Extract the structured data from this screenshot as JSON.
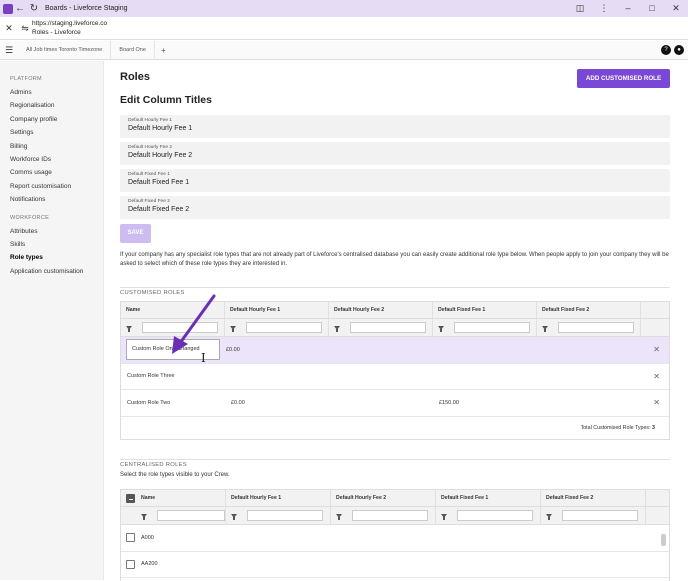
{
  "browser": {
    "window_title": "Boards - Liveforce Staging",
    "url": "https://staging.liveforce.co",
    "page_title": "Roles - Liveforce",
    "tabs": [
      "All Job times Toronto Timezone",
      "Board One"
    ],
    "help_glyph": "?",
    "bell_glyph": "●"
  },
  "sidebar": {
    "platform_heading": "PLATFORM",
    "platform_items": [
      "Admins",
      "Regionalisation",
      "Company profile",
      "Settings",
      "Billing",
      "Workforce IDs",
      "Comms usage",
      "Report customisation",
      "Notifications"
    ],
    "workforce_heading": "WORKFORCE",
    "workforce_items": [
      "Attributes",
      "Skills",
      "Role types",
      "Application customisation"
    ],
    "active_item": "Role types"
  },
  "main": {
    "title": "Roles",
    "add_button": "ADD CUSTOMISED ROLE",
    "edit_title": "Edit Column Titles",
    "fields": [
      {
        "label": "Default Hourly Fee 1",
        "value": "Default Hourly Fee 1"
      },
      {
        "label": "Default Hourly Fee 2",
        "value": "Default Hourly Fee 2"
      },
      {
        "label": "Default Fixed Fee 1",
        "value": "Default Fixed Fee 1"
      },
      {
        "label": "Default Fixed Fee 2",
        "value": "Default Fixed Fee 2"
      }
    ],
    "save_button": "SAVE",
    "info_text": "If your company has any specialist role types that are not already part of Liveforce's centralised database you can easily create additional role type below. When people apply to join your company they will be asked to select which of these role types they are interested in."
  },
  "customised": {
    "heading": "CUSTOMISED ROLES",
    "columns": [
      "Name",
      "Default Hourly Fee 1",
      "Default Hourly Fee 2",
      "Default Fixed Fee 1",
      "Default Fixed Fee 2"
    ],
    "rows": [
      {
        "name": "Custom Role One Changed",
        "hourly1": "£0.00",
        "hourly2": "",
        "fixed1": "",
        "fixed2": ""
      },
      {
        "name": "Custom Role Three",
        "hourly1": "",
        "hourly2": "",
        "fixed1": "",
        "fixed2": ""
      },
      {
        "name": "Custom Role Two",
        "hourly1": "£0.00",
        "hourly2": "",
        "fixed1": "£150.00",
        "fixed2": ""
      }
    ],
    "total_label": "Total Customised Role Types:",
    "total_value": "3"
  },
  "centralised": {
    "heading": "CENTRALISED ROLES",
    "subtitle": "Select the role types visible to your Crew.",
    "columns": [
      "Name",
      "Default Hourly Fee 1",
      "Default Hourly Fee 2",
      "Default Fixed Fee 1",
      "Default Fixed Fee 2"
    ],
    "rows": [
      "A000",
      "AA200"
    ]
  },
  "colors": {
    "accent": "#7a48d6",
    "arrow": "#6b2fb5",
    "selected_row": "#ece4fa"
  }
}
